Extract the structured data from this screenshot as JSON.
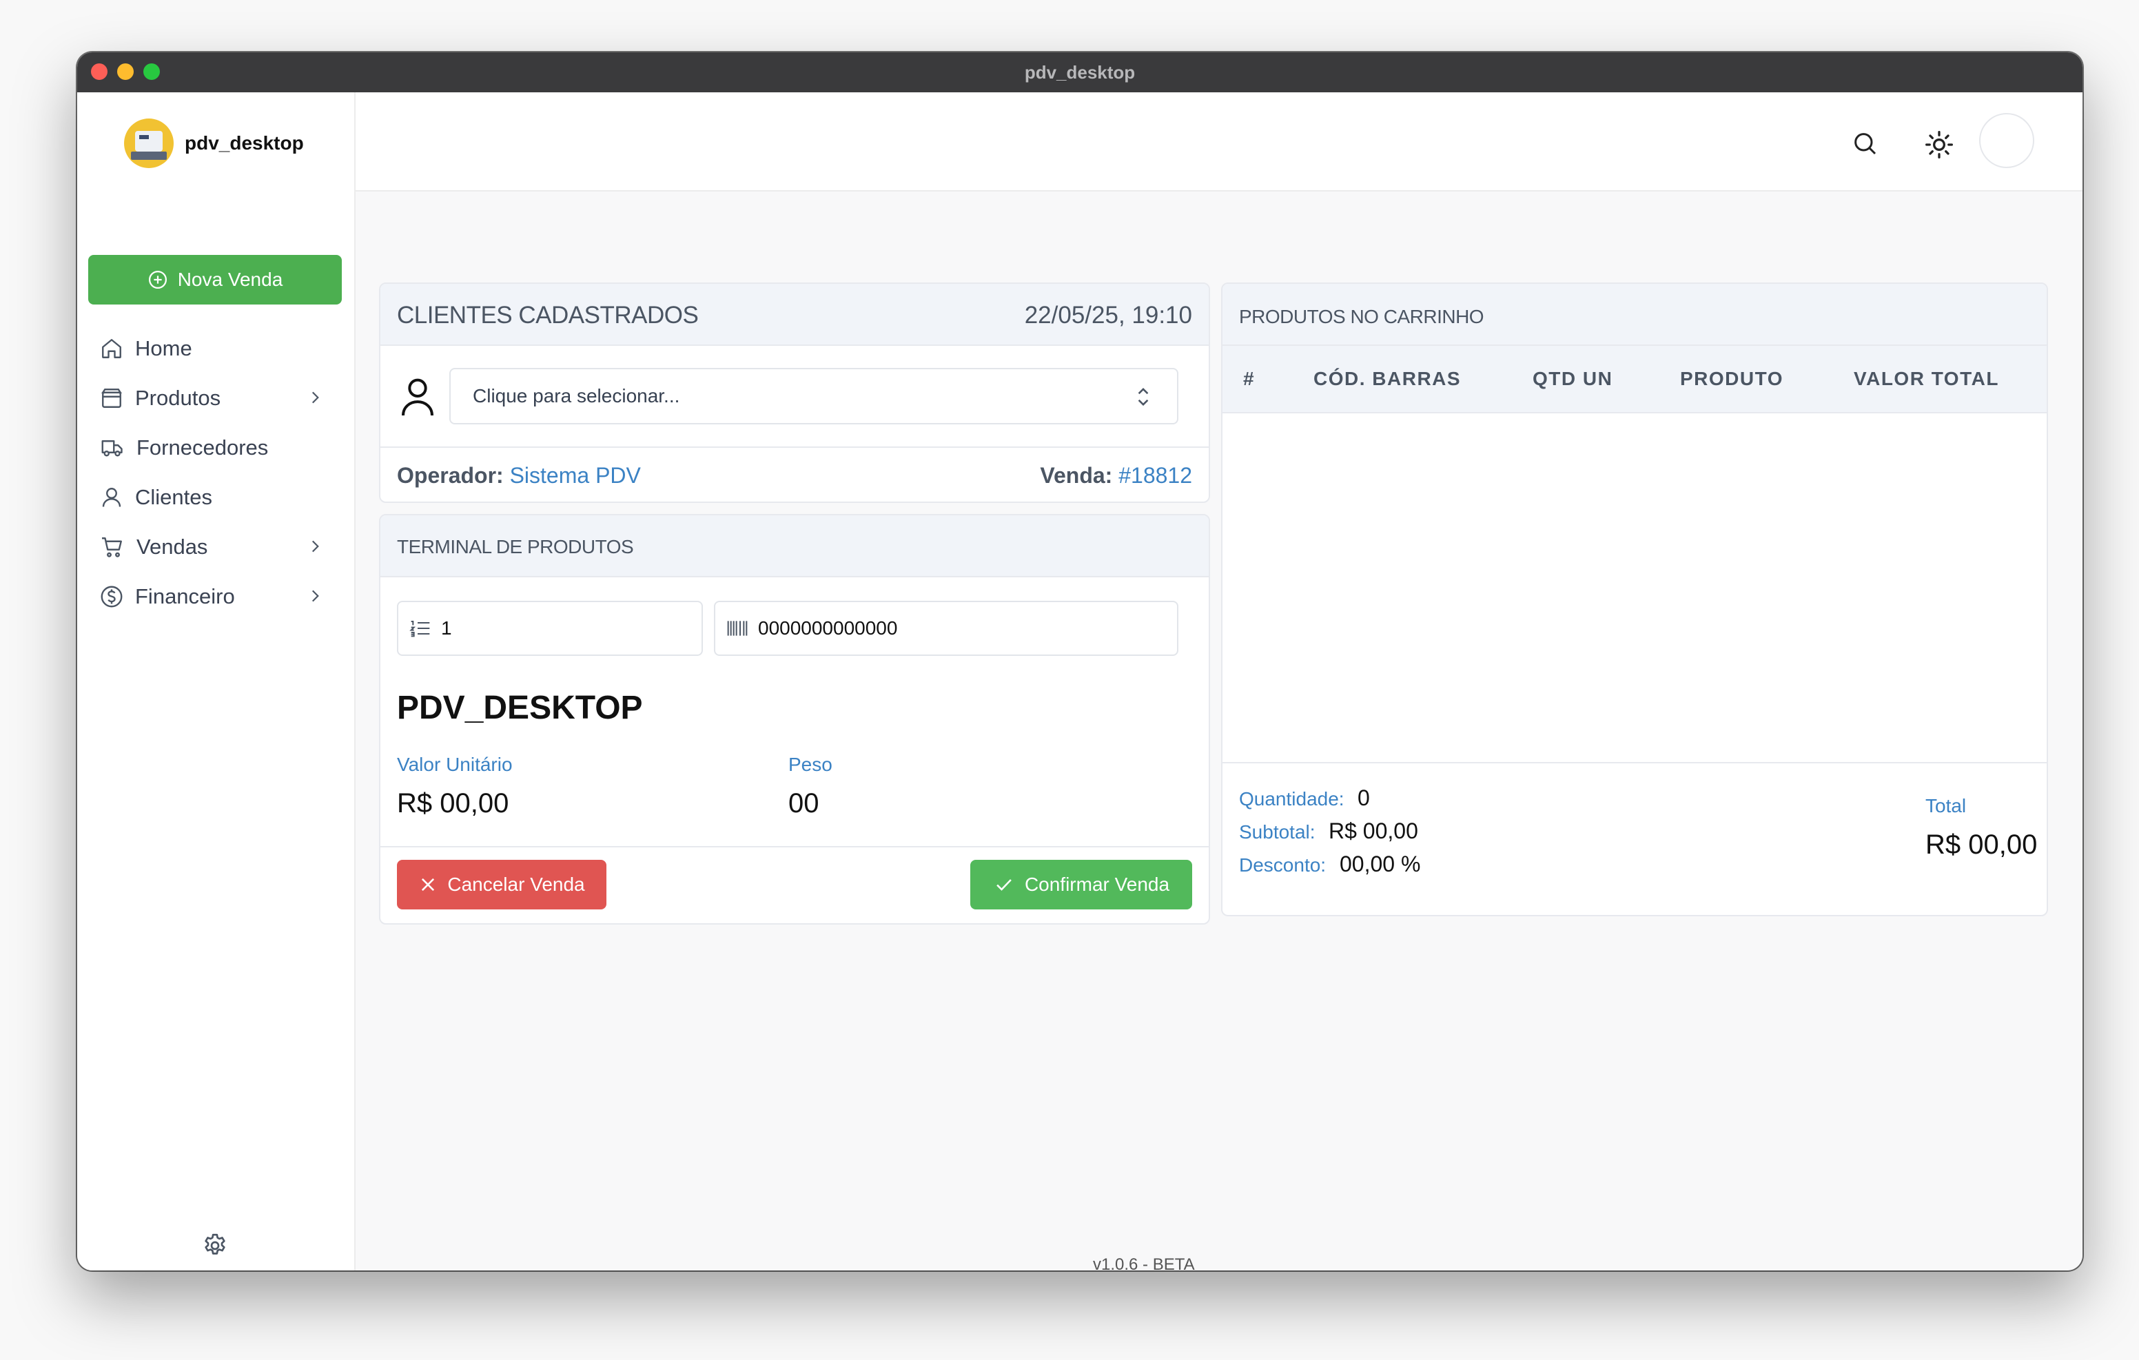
{
  "window": {
    "title": "pdv_desktop"
  },
  "sidebar": {
    "brand": "pdv_desktop",
    "new_sale_label": "Nova Venda",
    "items": [
      {
        "label": "Home",
        "icon": "home-icon",
        "has_submenu": false
      },
      {
        "label": "Produtos",
        "icon": "box-icon",
        "has_submenu": true
      },
      {
        "label": "Fornecedores",
        "icon": "truck-icon",
        "has_submenu": false
      },
      {
        "label": "Clientes",
        "icon": "user-icon",
        "has_submenu": false
      },
      {
        "label": "Vendas",
        "icon": "cart-icon",
        "has_submenu": true
      },
      {
        "label": "Financeiro",
        "icon": "dollar-icon",
        "has_submenu": true
      }
    ]
  },
  "clients": {
    "title": "CLIENTES CADASTRADOS",
    "datetime": "22/05/25, 19:10",
    "select_placeholder": "Clique para selecionar...",
    "operator_label": "Operador:",
    "operator_value": "Sistema PDV",
    "sale_label": "Venda:",
    "sale_value": "#18812"
  },
  "terminal": {
    "title": "TERMINAL DE PRODUTOS",
    "quantity_value": "1",
    "barcode_value": "0000000000000",
    "product_name": "PDV_DESKTOP",
    "unit_price_label": "Valor Unitário",
    "unit_price_value": "R$ 00,00",
    "weight_label": "Peso",
    "weight_value": "00",
    "cancel_label": "Cancelar Venda",
    "confirm_label": "Confirmar Venda"
  },
  "cart": {
    "title": "PRODUTOS NO CARRINHO",
    "columns": [
      "#",
      "CÓD. BARRAS",
      "QTD UN",
      "PRODUTO",
      "VALOR TOTAL"
    ],
    "rows": [],
    "quantity_label": "Quantidade:",
    "quantity_value": "0",
    "subtotal_label": "Subtotal:",
    "subtotal_value": "R$ 00,00",
    "discount_label": "Desconto:",
    "discount_value": "00,00 %",
    "total_label": "Total",
    "total_value": "R$ 00,00"
  },
  "footer": {
    "version": "v1.0.6 - BETA"
  },
  "colors": {
    "primary_green": "#4caf50",
    "danger_red": "#e05552",
    "link_blue": "#3b82c4"
  }
}
